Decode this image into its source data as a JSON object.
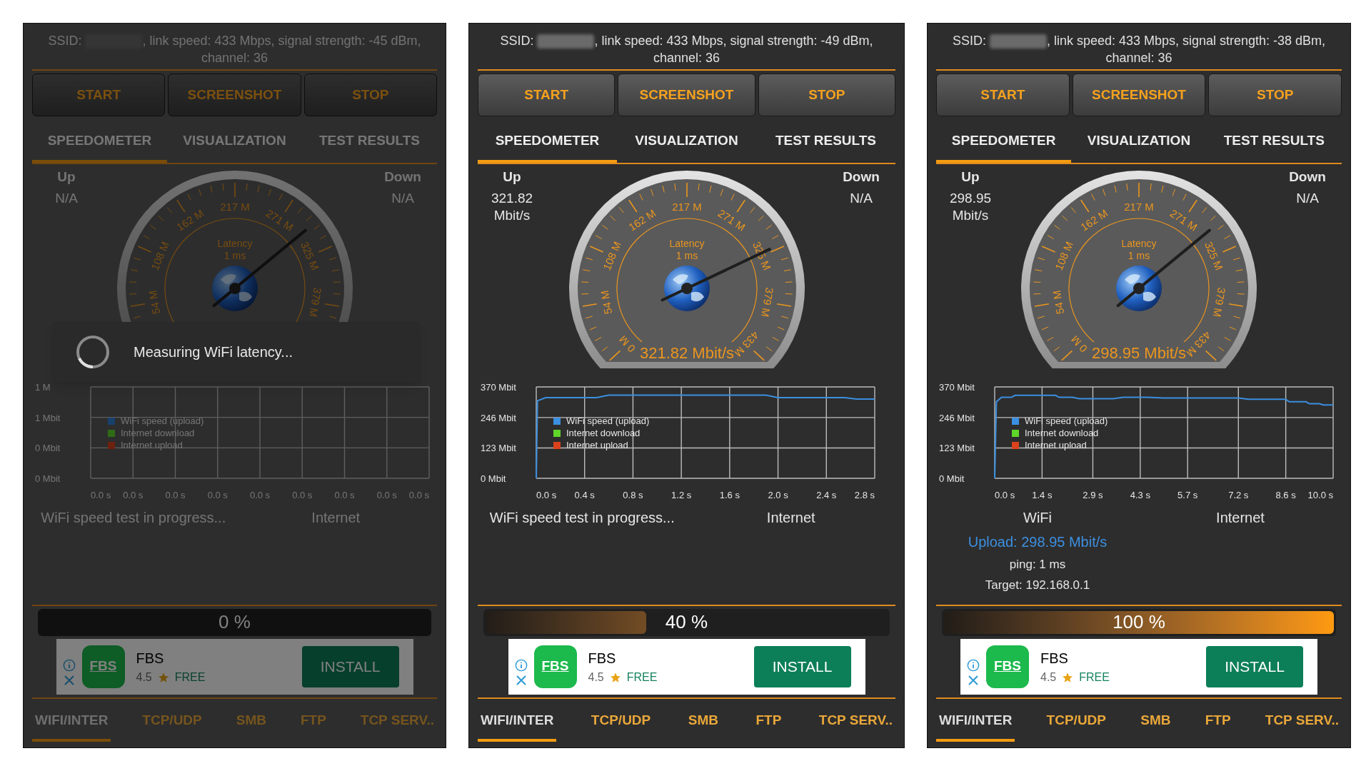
{
  "panels": [
    {
      "dimmed": true,
      "info": {
        "label": "SSID:",
        "detail": ", link speed: 433 Mbps, signal strength: -45 dBm, channel: 36"
      },
      "buttons": [
        "START",
        "SCREENSHOT",
        "STOP"
      ],
      "tabs": [
        {
          "label": "SPEEDOMETER",
          "selected": true
        },
        {
          "label": "VISUALIZATION",
          "selected": false
        },
        {
          "label": "TEST RESULTS",
          "selected": false
        }
      ],
      "up": {
        "label": "Up",
        "value": "N/A"
      },
      "down": {
        "label": "Down",
        "value": "N/A"
      },
      "gauge": {
        "scale_labels": [
          "54 M",
          "108 M",
          "162 M",
          "217 M",
          "271 M",
          "325 M",
          "379 M"
        ],
        "latency_label": "Latency",
        "latency_value": "1 ms",
        "level": 0.69
      },
      "chart": {
        "chart_data": {
          "type": "line",
          "grid": true,
          "ylim": [
            0,
            1
          ],
          "categories": [
            "0.0 s",
            "0.0 s",
            "0.0 s",
            "0.0 s",
            "0.0 s",
            "0.0 s",
            "0.0 s",
            "0.0 s",
            "0.0 s"
          ],
          "yticks": [
            {
              "value": 0,
              "label": "0 Mbit"
            },
            {
              "value": 0.333,
              "label": "0 Mbit"
            },
            {
              "value": 0.667,
              "label": "1 Mbit"
            },
            {
              "value": 1,
              "label": "1 M"
            }
          ],
          "series": [
            {
              "name": "WiFi speed (upload)",
              "color": "#2f7fd8",
              "values": [
                null,
                null,
                null,
                null,
                null,
                null,
                null,
                null,
                null
              ]
            },
            {
              "name": "Internet download",
              "color": "#5ed62a",
              "values": [
                null,
                null,
                null,
                null,
                null,
                null,
                null,
                null,
                null
              ]
            },
            {
              "name": "Internet upload",
              "color": "#d9421c",
              "values": [
                null,
                null,
                null,
                null,
                null,
                null,
                null,
                null,
                null
              ]
            }
          ]
        }
      },
      "status": {
        "left": "WiFi speed test in progress...",
        "right": "Internet"
      },
      "progress": {
        "label": "0 %",
        "level": 0
      },
      "ad": {
        "logo": "FBS",
        "name": "FBS",
        "rating": "4.5",
        "price": "FREE",
        "button": "INSTALL"
      },
      "bottom_tabs": [
        {
          "label": "WIFI/INTER",
          "selected": true
        },
        {
          "label": "TCP/UDP",
          "selected": false
        },
        {
          "label": "SMB",
          "selected": false
        },
        {
          "label": "FTP",
          "selected": false
        },
        {
          "label": "TCP SERV..",
          "selected": false
        }
      ],
      "dialog": {
        "message": "Measuring WiFi latency..."
      }
    },
    {
      "dimmed": false,
      "info": {
        "label": "SSID:",
        "detail": ", link speed: 433 Mbps, signal strength: -49 dBm, channel: 36"
      },
      "buttons": [
        "START",
        "SCREENSHOT",
        "STOP"
      ],
      "tabs": [
        {
          "label": "SPEEDOMETER",
          "selected": true
        },
        {
          "label": "VISUALIZATION",
          "selected": false
        },
        {
          "label": "TEST RESULTS",
          "selected": false
        }
      ],
      "up": {
        "label": "Up",
        "value": "321.82 Mbit/s"
      },
      "down": {
        "label": "Down",
        "value": "N/A"
      },
      "gauge": {
        "scale_labels": [
          "0 M",
          "54 M",
          "108 M",
          "162 M",
          "217 M",
          "271 M",
          "325 M",
          "379 M",
          "433 M"
        ],
        "latency_label": "Latency",
        "latency_value": "1 ms",
        "reading": "321.82 Mbit/s",
        "level": 0.743
      },
      "chart": {
        "chart_data": {
          "type": "line",
          "grid": true,
          "xlim": [
            0,
            2.8
          ],
          "ylim": [
            0,
            370
          ],
          "xticks": [
            {
              "value": 0,
              "label": "0.0 s"
            },
            {
              "value": 0.4,
              "label": "0.4 s"
            },
            {
              "value": 0.8,
              "label": "0.8 s"
            },
            {
              "value": 1.2,
              "label": "1.2 s"
            },
            {
              "value": 1.6,
              "label": "1.6 s"
            },
            {
              "value": 2.0,
              "label": "2.0 s"
            },
            {
              "value": 2.4,
              "label": "2.4 s"
            },
            {
              "value": 2.8,
              "label": "2.8 s"
            }
          ],
          "yticks": [
            {
              "value": 0,
              "label": "0 Mbit"
            },
            {
              "value": 123,
              "label": "123 Mbit"
            },
            {
              "value": 246,
              "label": "246 Mbit"
            },
            {
              "value": 370,
              "label": "370 Mbit"
            }
          ],
          "x": [
            0,
            0.01,
            0.08,
            0.5,
            0.6,
            1.9,
            2.0,
            2.55,
            2.65,
            2.8
          ],
          "series": [
            {
              "name": "WiFi speed (upload)",
              "color": "#3b8fe0",
              "values": [
                0,
                314,
                327,
                327,
                337,
                337,
                327,
                327,
                321,
                321
              ]
            },
            {
              "name": "Internet download",
              "color": "#5ed62a",
              "values": [
                null,
                null,
                null,
                null,
                null,
                null,
                null,
                null,
                null,
                null
              ]
            },
            {
              "name": "Internet upload",
              "color": "#d9421c",
              "values": [
                null,
                null,
                null,
                null,
                null,
                null,
                null,
                null,
                null,
                null
              ]
            }
          ]
        }
      },
      "status": {
        "left": "WiFi speed test in progress...",
        "right": "Internet"
      },
      "progress": {
        "label": "40 %",
        "level": 0.4
      },
      "ad": {
        "logo": "FBS",
        "name": "FBS",
        "rating": "4.5",
        "price": "FREE",
        "button": "INSTALL"
      },
      "bottom_tabs": [
        {
          "label": "WIFI/INTER",
          "selected": true
        },
        {
          "label": "TCP/UDP",
          "selected": false
        },
        {
          "label": "SMB",
          "selected": false
        },
        {
          "label": "FTP",
          "selected": false
        },
        {
          "label": "TCP SERV..",
          "selected": false
        }
      ]
    },
    {
      "dimmed": false,
      "info": {
        "label": "SSID:",
        "detail": ", link speed: 433 Mbps, signal strength: -38 dBm, channel: 36"
      },
      "buttons": [
        "START",
        "SCREENSHOT",
        "STOP"
      ],
      "tabs": [
        {
          "label": "SPEEDOMETER",
          "selected": true
        },
        {
          "label": "VISUALIZATION",
          "selected": false
        },
        {
          "label": "TEST RESULTS",
          "selected": false
        }
      ],
      "up": {
        "label": "Up",
        "value": "298.95 Mbit/s"
      },
      "down": {
        "label": "Down",
        "value": "N/A"
      },
      "gauge": {
        "scale_labels": [
          "0 M",
          "54 M",
          "108 M",
          "162 M",
          "217 M",
          "271 M",
          "325 M",
          "379 M",
          "433 M"
        ],
        "latency_label": "Latency",
        "latency_value": "1 ms",
        "reading": "298.95 Mbit/s",
        "level": 0.69
      },
      "chart": {
        "chart_data": {
          "type": "line",
          "grid": true,
          "xlim": [
            0,
            10
          ],
          "ylim": [
            0,
            370
          ],
          "xticks": [
            {
              "value": 0,
              "label": "0.0 s"
            },
            {
              "value": 1.4,
              "label": "1.4 s"
            },
            {
              "value": 2.9,
              "label": "2.9 s"
            },
            {
              "value": 4.3,
              "label": "4.3 s"
            },
            {
              "value": 5.7,
              "label": "5.7 s"
            },
            {
              "value": 7.2,
              "label": "7.2 s"
            },
            {
              "value": 8.6,
              "label": "8.6 s"
            },
            {
              "value": 10,
              "label": "10.0 s"
            }
          ],
          "yticks": [
            {
              "value": 0,
              "label": "0 Mbit"
            },
            {
              "value": 123,
              "label": "123 Mbit"
            },
            {
              "value": 246,
              "label": "246 Mbit"
            },
            {
              "value": 370,
              "label": "370 Mbit"
            }
          ],
          "x": [
            0,
            0.05,
            0.2,
            0.5,
            0.6,
            1.8,
            1.9,
            2.3,
            2.5,
            3.5,
            3.8,
            4.5,
            5.0,
            7.2,
            7.5,
            8.6,
            8.7,
            9.2,
            9.3,
            9.6,
            9.7,
            10
          ],
          "series": [
            {
              "name": "WiFi speed (upload)",
              "color": "#3b8fe0",
              "values": [
                0,
                310,
                328,
                328,
                336,
                336,
                328,
                328,
                322,
                322,
                328,
                328,
                325,
                325,
                320,
                320,
                310,
                310,
                302,
                302,
                297,
                297
              ]
            },
            {
              "name": "Internet download",
              "color": "#5ed62a",
              "values": [
                null,
                null,
                null,
                null,
                null,
                null,
                null,
                null,
                null,
                null,
                null,
                null,
                null,
                null,
                null,
                null,
                null,
                null,
                null,
                null,
                null,
                null
              ]
            },
            {
              "name": "Internet upload",
              "color": "#d9421c",
              "values": [
                null,
                null,
                null,
                null,
                null,
                null,
                null,
                null,
                null,
                null,
                null,
                null,
                null,
                null,
                null,
                null,
                null,
                null,
                null,
                null,
                null,
                null
              ]
            }
          ]
        }
      },
      "status": {
        "left": "WiFi",
        "right": "Internet"
      },
      "results": {
        "upload": "Upload: 298.95 Mbit/s",
        "ping": "ping: 1 ms",
        "target": "Target: 192.168.0.1"
      },
      "progress": {
        "label": "100 %",
        "level": 1
      },
      "ad": {
        "logo": "FBS",
        "name": "FBS",
        "rating": "4.5",
        "price": "FREE",
        "button": "INSTALL"
      },
      "bottom_tabs": [
        {
          "label": "WIFI/INTER",
          "selected": true
        },
        {
          "label": "TCP/UDP",
          "selected": false
        },
        {
          "label": "SMB",
          "selected": false
        },
        {
          "label": "FTP",
          "selected": false
        },
        {
          "label": "TCP SERV..",
          "selected": false
        }
      ]
    }
  ]
}
